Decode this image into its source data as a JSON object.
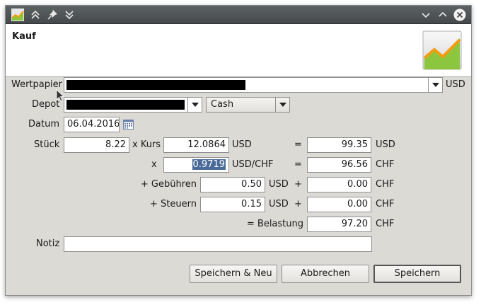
{
  "window": {
    "title_icons": [
      "app-chart-icon",
      "double-chevron-up-icon",
      "pin-icon",
      "double-chevron-down-icon"
    ],
    "controls": [
      "minimize-chevron-icon",
      "maximize-chevron-icon",
      "close-icon"
    ]
  },
  "header": {
    "title": "Kauf"
  },
  "form": {
    "wertpapier_label": "Wertpapier",
    "wertpapier_currency": "USD",
    "depot_label": "Depot",
    "cash_value": "Cash",
    "datum_label": "Datum",
    "datum_value": "06.04.2016",
    "stueck_label": "Stück",
    "stueck_value": "8.22",
    "kurs_label": "x Kurs",
    "kurs_value": "12.0864",
    "kurs_currency": "USD",
    "eq1": "=",
    "total_value": "99.35",
    "total_currency": "USD",
    "fx_label": "x",
    "fx_value": "0.9719",
    "fx_currency": "USD/CHF",
    "eq2": "=",
    "converted_value": "96.56",
    "converted_currency": "CHF",
    "gebuehren_label": "+ Gebühren",
    "gebuehren_value": "0.50",
    "gebuehren_currency": "USD",
    "plus1": "+",
    "gebuehren_chf_value": "0.00",
    "gebuehren_chf_currency": "CHF",
    "steuern_label": "+ Steuern",
    "steuern_value": "0.15",
    "steuern_currency": "USD",
    "plus2": "+",
    "steuern_chf_value": "0.00",
    "steuern_chf_currency": "CHF",
    "belastung_label": "= Belastung",
    "belastung_value": "97.20",
    "belastung_currency": "CHF",
    "notiz_label": "Notiz",
    "notiz_value": ""
  },
  "buttons": {
    "save_new": "Speichern & Neu",
    "cancel": "Abbrechen",
    "save": "Speichern"
  },
  "colors": {
    "titlebar": "#4f5456",
    "dialog_bg": "#dcdad5",
    "selection": "#4a6b9a"
  }
}
